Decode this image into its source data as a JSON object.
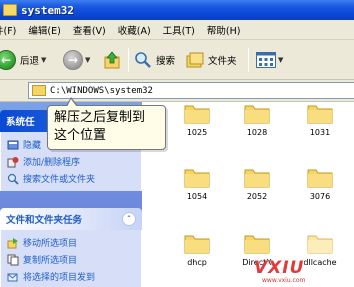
{
  "window": {
    "title": "system32"
  },
  "menu": [
    {
      "label": "件(F)"
    },
    {
      "label": "编辑(E)"
    },
    {
      "label": "查看(V)"
    },
    {
      "label": "收藏(A)"
    },
    {
      "label": "工具(T)"
    },
    {
      "label": "帮助(H)"
    }
  ],
  "toolbar": {
    "back_label": "后退",
    "search_label": "搜索",
    "folders_label": "文件夹"
  },
  "address": {
    "path": "C:\\WINDOWS\\system32"
  },
  "callout": {
    "line1": "解压之后复制到",
    "line2": "这个位置"
  },
  "taskpane": {
    "system_tasks": {
      "title": "系统任",
      "items": [
        {
          "label": "隐藏"
        },
        {
          "label": "添加/删除程序"
        },
        {
          "label": "搜索文件或文件夹"
        }
      ]
    },
    "file_tasks": {
      "title": "文件和文件夹任务",
      "items": [
        {
          "label": "移动所选项目"
        },
        {
          "label": "复制所选项目"
        },
        {
          "label": "将选择的项目发到"
        }
      ]
    }
  },
  "files": [
    {
      "name": "1025"
    },
    {
      "name": "1028"
    },
    {
      "name": "1031"
    },
    {
      "name": "1054"
    },
    {
      "name": "2052"
    },
    {
      "name": "3076"
    },
    {
      "name": "dhcp"
    },
    {
      "name": "DirectX"
    },
    {
      "name": "dllcache"
    }
  ],
  "watermark": {
    "text": "VXIU",
    "sub": "www.vxiu.com"
  },
  "colors": {
    "titlebar": "#0b48d6",
    "taskpane_bg": "#6f8fdf",
    "task_link": "#215dc6",
    "folder": "#f5d46a",
    "callout_bg": "#fffde8",
    "watermark": "#e23a3a"
  }
}
